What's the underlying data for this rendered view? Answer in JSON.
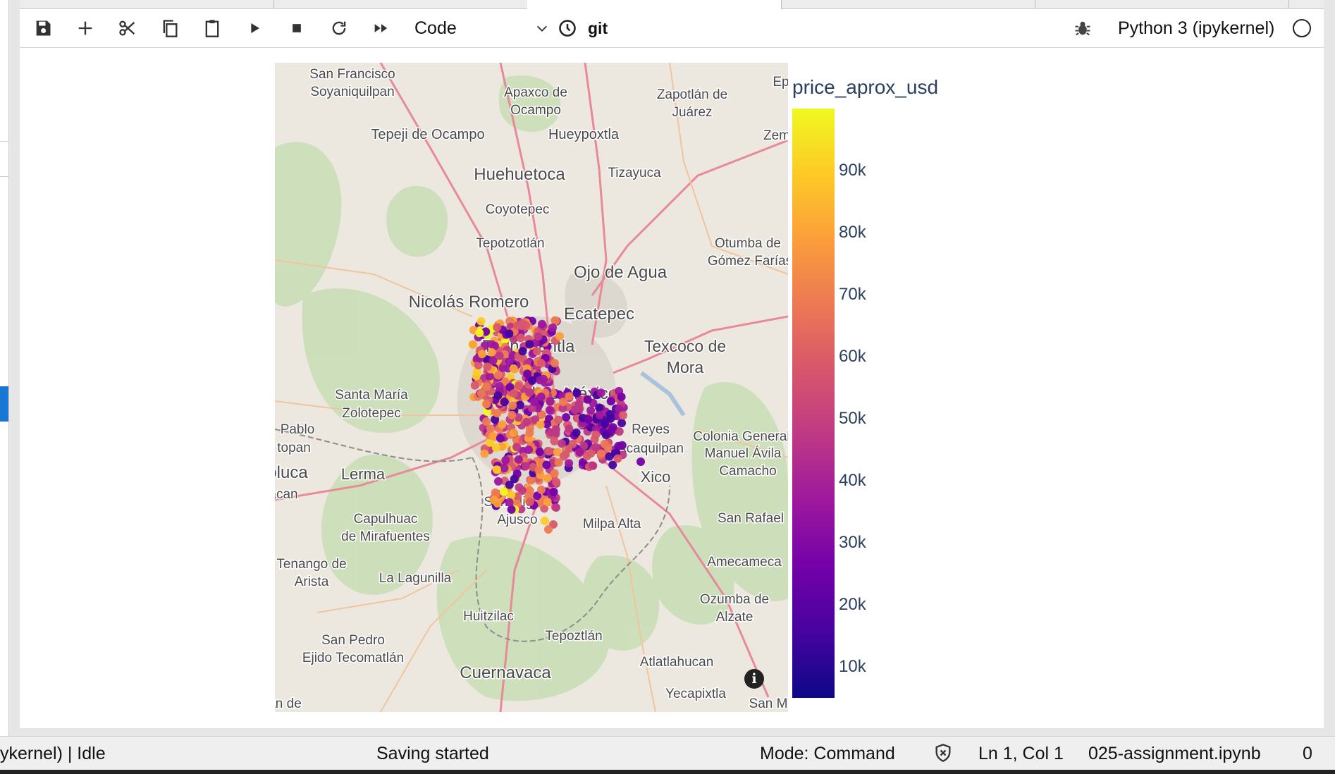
{
  "toolbar": {
    "cell_type": "Code",
    "git_label": "git",
    "kernel_name": "Python 3 (ipykernel)"
  },
  "map": {
    "places": [
      "San Francisco",
      "Soyaniquilpan",
      "Apaxco de",
      "Ocampo",
      "Zapotlán de",
      "Juárez",
      "Tepeji de Ocampo",
      "Hueypoxtla",
      "Huehuetoca",
      "Tizayuca",
      "Coyotepec",
      "Tepotzotlán",
      "Otumba de",
      "Gómez Farías",
      "Ojo de Agua",
      "Nicolás Romero",
      "Ecatepec",
      "Tlalnepantla",
      "Texcoco de",
      "Mora",
      "Ciudad de México",
      "Santa María",
      "Zolotepec",
      "Reyes",
      "Acaquilpan",
      "Colonia General",
      "Manuel Ávila",
      "Camacho",
      "Pablo",
      "topan",
      "oluca",
      "Lerma",
      "acan",
      "Xico",
      "San Miguel",
      "Ajusco",
      "Capulhuac",
      "de Mirafuentes",
      "Milpa Alta",
      "San Rafael",
      "Tenango de",
      "Arista",
      "La Lagunilla",
      "Amecameca",
      "Ozumba de",
      "Alzate",
      "Huitzilac",
      "Tepoztlán",
      "San Pedro",
      "Ejido Tecomatlán",
      "Atlatlahucan",
      "Cuernavaca",
      "Yecapixtla",
      "Ep",
      "Zem",
      "an de",
      "San M"
    ],
    "info_label": "i"
  },
  "colorbar": {
    "title": "price_aprox_usd",
    "ticks": [
      "90k",
      "80k",
      "70k",
      "60k",
      "50k",
      "40k",
      "30k",
      "20k",
      "10k"
    ]
  },
  "chart_data": {
    "type": "scatter",
    "title": "",
    "color_by": "price_aprox_usd",
    "colorscale": "Plasma",
    "color_range": [
      5000,
      100000
    ],
    "colorbar_ticks": [
      10000,
      20000,
      30000,
      40000,
      50000,
      60000,
      70000,
      80000,
      90000
    ],
    "cluster_description": "Properties clustered over Mexico City metro area"
  },
  "status": {
    "kernel_state": "ykernel) | Idle",
    "saving": "Saving started",
    "mode": "Mode: Command",
    "position": "Ln 1, Col 1",
    "filename": "025-assignment.ipynb",
    "count": "0"
  }
}
